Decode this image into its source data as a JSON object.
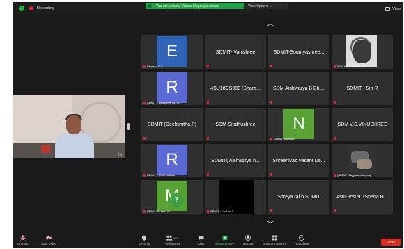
{
  "topbar": {
    "recording_label": "Recording",
    "share_banner": "You are viewing Vishnu Nagaraj's screen",
    "view_options": "View Options",
    "view_button": "View"
  },
  "speaker": {
    "overlay_text": "In"
  },
  "gallery": {
    "tiles": [
      {
        "type": "avatar",
        "letter": "E",
        "color": "#2f64b6",
        "label": "Eramma S K"
      },
      {
        "type": "name",
        "name": "SDMIT- Vanishree"
      },
      {
        "type": "name",
        "name": "SDMIT-Soumyashree..."
      },
      {
        "type": "photo",
        "label": "SDM Varun Hebbar B S"
      },
      {
        "type": "avatar",
        "letter": "R",
        "color": "#5a6ad2",
        "label": "SDMIT – Rajeshwari S. G..."
      },
      {
        "type": "name",
        "name": "4SU18CS080 (Shara..."
      },
      {
        "type": "name",
        "name": "SDM Aishwarya B Bhi..."
      },
      {
        "type": "name",
        "name": "SDMIT - Siri R"
      },
      {
        "type": "name",
        "name": "SDMIT (Deekshitha.P)"
      },
      {
        "type": "name",
        "name": "SDM-Sindhushree"
      },
      {
        "type": "avatar",
        "letter": "N",
        "color": "#58a235",
        "label": "SDMIT- Nikitha S"
      },
      {
        "type": "name",
        "name": "SDM V.S.VINUSHREE"
      },
      {
        "type": "avatar",
        "letter": "R",
        "color": "#5a6ad2",
        "label": "SDMIT – Rohit Mahale"
      },
      {
        "type": "name",
        "name": "SDMIT( Aishwarya n..."
      },
      {
        "type": "name",
        "name": "Shreenivas Vasant De..."
      },
      {
        "type": "photo2",
        "label": "(SDMIT –Nagasumathi ms)"
      },
      {
        "type": "avatar-q",
        "letter": "M",
        "color": "#58a235",
        "label": "SDMIT–Revathi M"
      },
      {
        "type": "black",
        "label": "SDMIT – Yashas P"
      },
      {
        "type": "name",
        "name": "Shreya rai b SDMIT"
      },
      {
        "type": "name",
        "name": "4su18cs091(Sneha H..."
      }
    ]
  },
  "toolbar": {
    "unmute": "Unmute",
    "start_video": "Start Video",
    "security": "Security",
    "participants": "Participants",
    "participants_count": "197",
    "chat": "Chat",
    "share_screen": "Share Screen",
    "record": "Record",
    "breakout_rooms": "Breakout Rooms",
    "reactions": "Reactions",
    "leave": "Leave"
  },
  "colors": {
    "accent_green": "#24a148",
    "leave_red": "#d92d20",
    "mute_red": "#e0282e"
  }
}
